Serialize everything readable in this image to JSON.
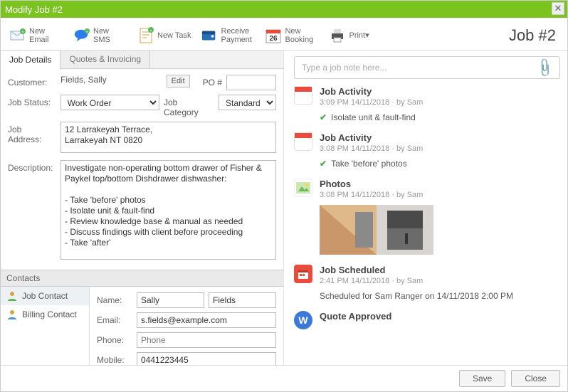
{
  "window": {
    "title": "Modify Job #2"
  },
  "toolbar": {
    "items": [
      {
        "label": "New Email"
      },
      {
        "label": "New SMS"
      },
      {
        "label": "New Task"
      },
      {
        "label": "Receive Payment"
      },
      {
        "label": "New Booking"
      },
      {
        "label": "Print"
      }
    ],
    "right_title": "Job #2",
    "calendar_day": "26"
  },
  "tabs": {
    "details": "Job Details",
    "quotes": "Quotes & Invoicing"
  },
  "form": {
    "customer_label": "Customer:",
    "customer_value": "Fields, Sally",
    "edit_btn": "Edit",
    "po_label": "PO #",
    "status_label": "Job Status:",
    "status_value": "Work Order",
    "category_label": "Job Category",
    "category_value": "Standard",
    "address_label": "Job Address:",
    "address_value": "12 Larrakeyah Terrace,\nLarrakeyah NT 0820",
    "desc_label": "Description:",
    "desc_value": "Investigate non-operating bottom drawer of Fisher & Paykel top/bottom Dishdrawer dishwasher:\n\n- Take 'before' photos\n- Isolate unit & fault-find\n- Review knowledge base & manual as needed\n- Discuss findings with client before proceeding\n- Take 'after'"
  },
  "contacts": {
    "header": "Contacts",
    "job_contact": "Job Contact",
    "billing_contact": "Billing Contact",
    "name_label": "Name:",
    "first_name": "Sally",
    "last_name": "Fields",
    "email_label": "Email:",
    "email_value": "s.fields@example.com",
    "phone_label": "Phone:",
    "phone_placeholder": "Phone",
    "mobile_label": "Mobile:",
    "mobile_value": "0441223445"
  },
  "note": {
    "placeholder": "Type a job note here..."
  },
  "feed": [
    {
      "title": "Job Activity",
      "meta": "3:09 PM 14/11/2018  ·  by Sam",
      "check": true,
      "body": "Isolate unit & fault-find"
    },
    {
      "title": "Job Activity",
      "meta": "3:08 PM 14/11/2018  ·  by Sam",
      "check": true,
      "body": "Take 'before' photos"
    },
    {
      "title": "Photos",
      "meta": "3:08 PM 14/11/2018  ·  by Sam",
      "photos": true
    },
    {
      "title": "Job Scheduled",
      "meta": "2:41 PM 14/11/2018  ·  by Sam",
      "body": "Scheduled for Sam Ranger on 14/11/2018 2:00 PM"
    },
    {
      "title": "Quote Approved"
    }
  ],
  "footer": {
    "save": "Save",
    "close": "Close"
  }
}
